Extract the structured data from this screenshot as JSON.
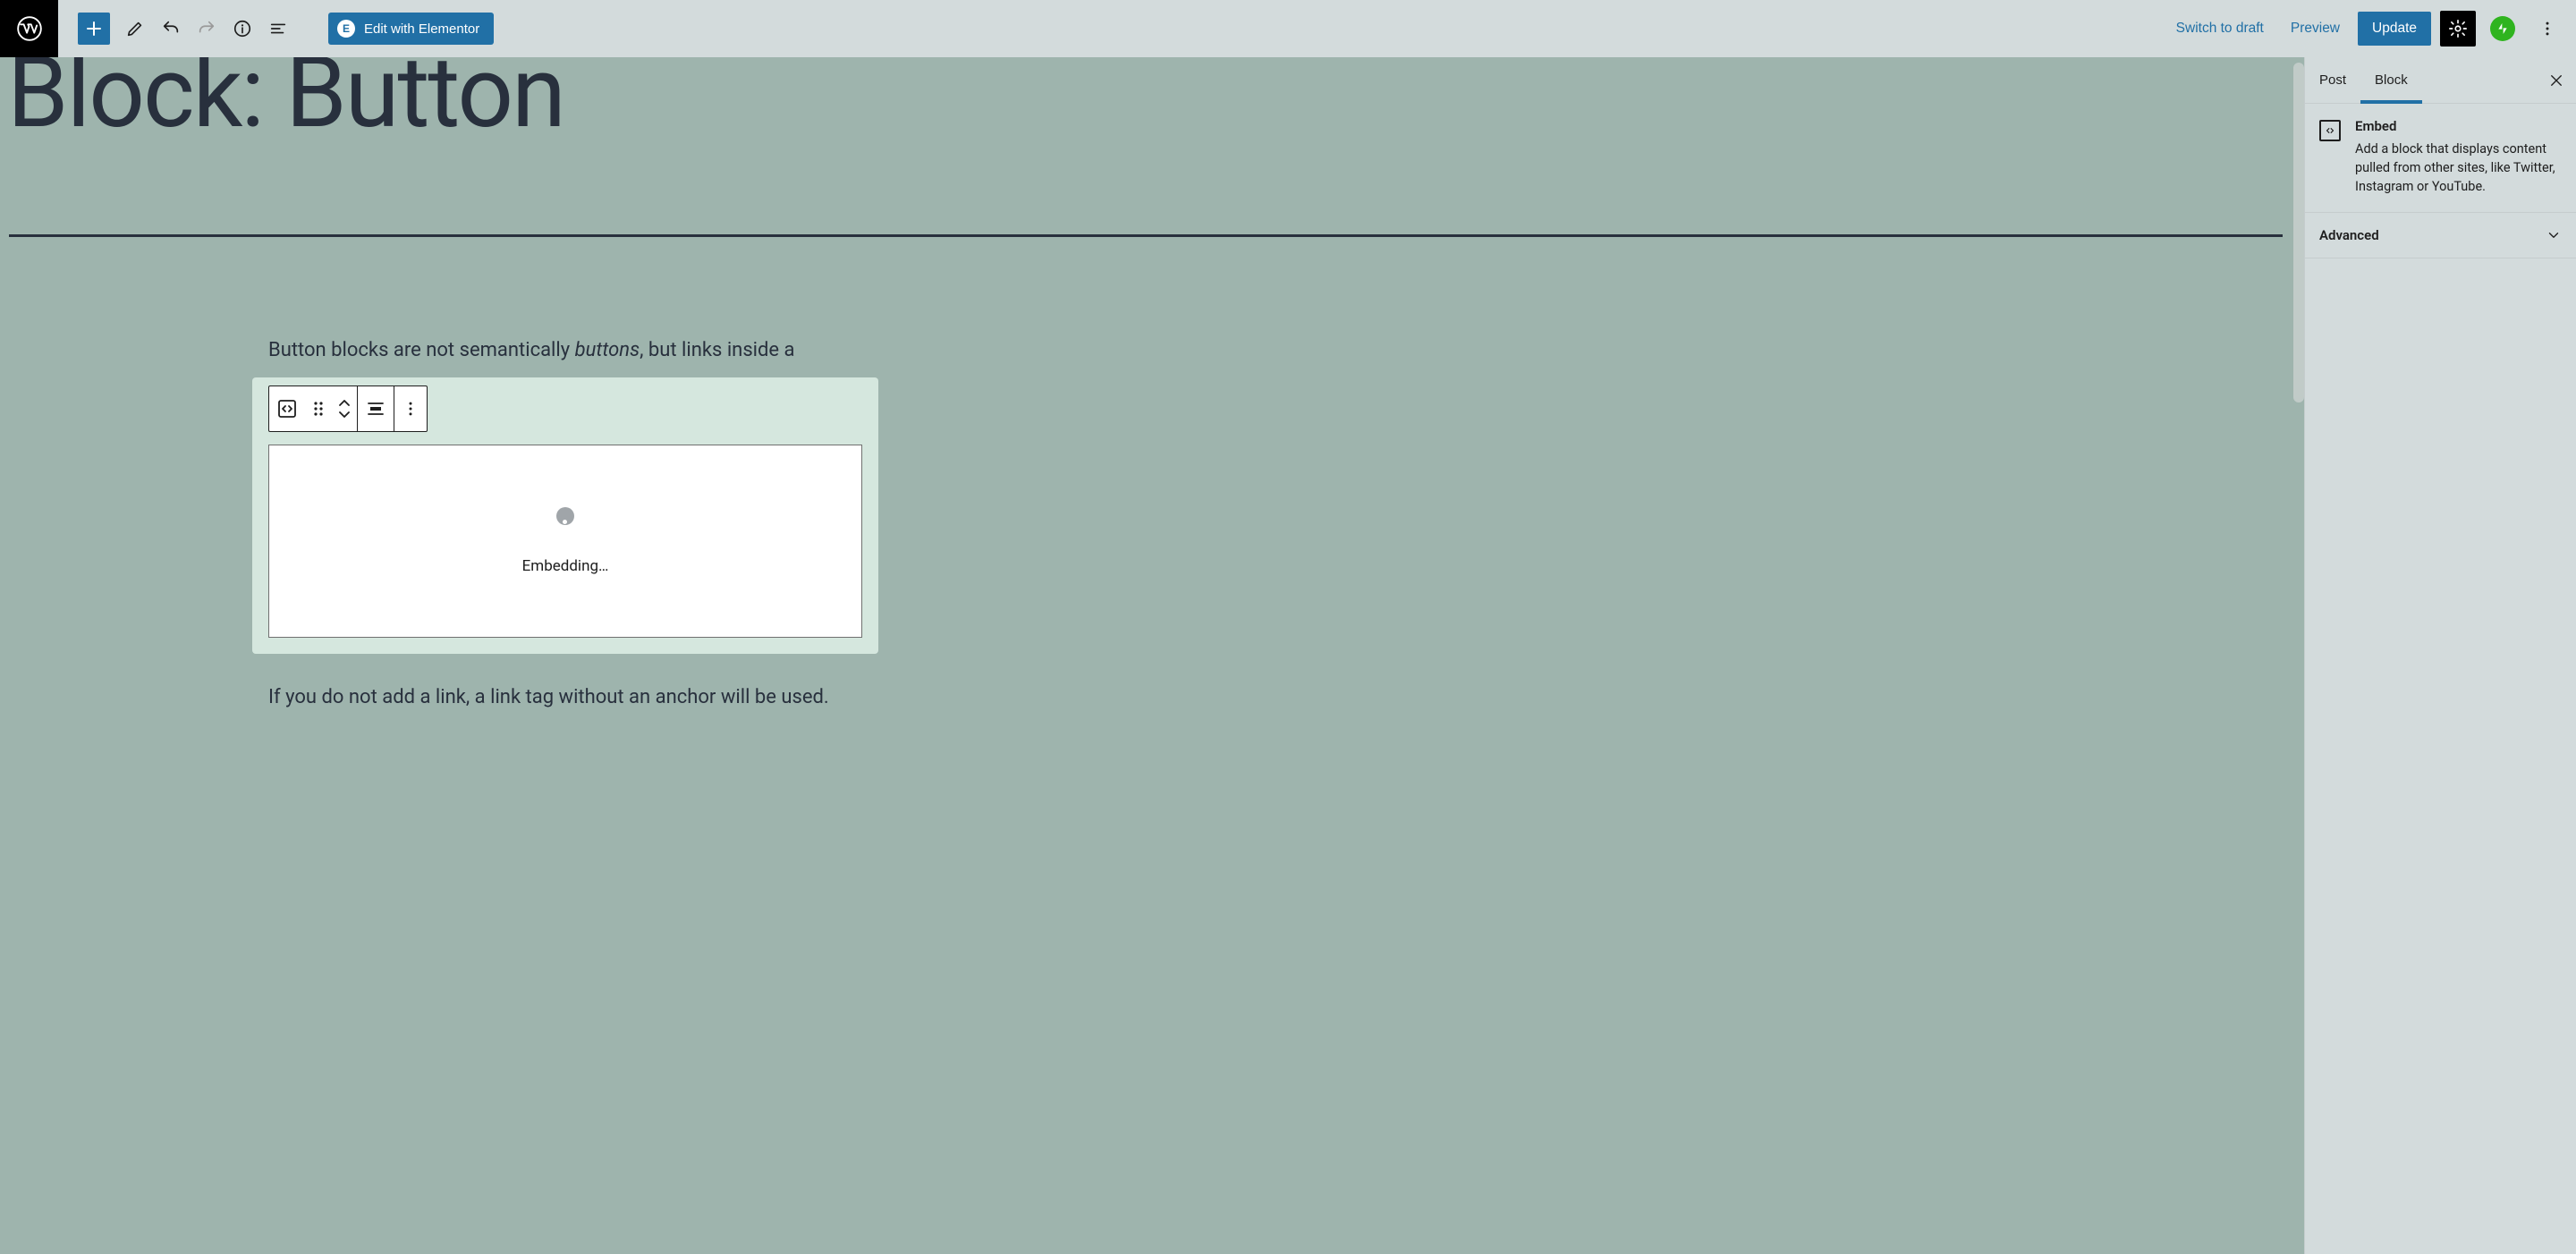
{
  "toolbar": {
    "elementor_label": "Edit with Elementor",
    "switch_draft": "Switch to draft",
    "preview": "Preview",
    "update": "Update"
  },
  "page": {
    "title": "Block: Button",
    "para_before_em": "Button blocks are not semantically ",
    "para_em": "buttons",
    "para_after_em": ", but links inside a",
    "para2": "If you do not add a link, a link tag without an anchor will be used."
  },
  "embed": {
    "status": "Embedding…"
  },
  "sidebar": {
    "tab_post": "Post",
    "tab_block": "Block",
    "block_name": "Embed",
    "block_desc": "Add a block that displays content pulled from other sites, like Twitter, Instagram or YouTube.",
    "advanced": "Advanced"
  }
}
